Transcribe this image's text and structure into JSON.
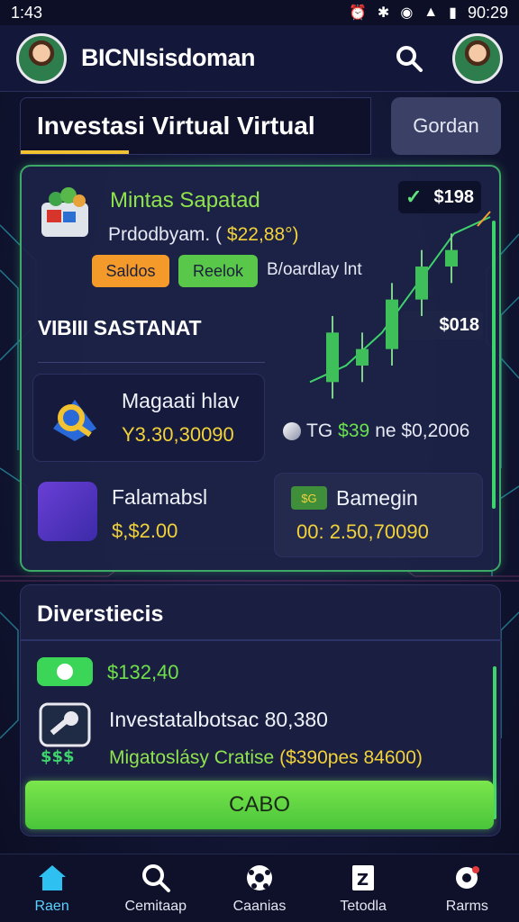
{
  "status_bar": {
    "time": "1:43",
    "clock": "90:29"
  },
  "header": {
    "title": "BICNIsisdoman"
  },
  "tabs": [
    {
      "label": "Investasi Virtual Virtual",
      "active": true
    },
    {
      "label": "Gordan",
      "active": false
    }
  ],
  "card": {
    "title": "Mintas Sapatad",
    "subtitle_prefix": "Prdodbyam. (",
    "subtitle_amount": "$22,88°)",
    "price_top": "$198",
    "badges": [
      "Saldos",
      "Reelok"
    ],
    "badge_side_text": "B/oardlay lnt",
    "section_label": "VIBIII SASTANAT",
    "price_mid": "$018",
    "sub_card_1": {
      "title": "Magaati hlav",
      "value": "Y3.30,30090"
    },
    "inline": {
      "prefix": "TG",
      "green": "$39",
      "suffix": "ne $0,2006"
    },
    "sub_card_2": {
      "title": "Falamabsl",
      "value": "$,$2.00"
    },
    "sub_card_3": {
      "icon_text": "$G",
      "title": "Bamegin",
      "value": "00: 2.50,70090"
    }
  },
  "panel2": {
    "title": "Diverstiecis",
    "cash_amount": "$132,40",
    "investment_title": "Investatalbotsac 80,380",
    "investment_sub_green": "Migatoslásy Cratise",
    "investment_sub_amount": "($390pes 84600)",
    "button_label": "CABO"
  },
  "bottom_nav": [
    {
      "label": "Raen",
      "icon": "home-icon",
      "active": true
    },
    {
      "label": "Cemitaap",
      "icon": "search-icon",
      "active": false
    },
    {
      "label": "Caanias",
      "icon": "soccer-ball-icon",
      "active": false
    },
    {
      "label": "Tetodla",
      "icon": "document-icon",
      "active": false
    },
    {
      "label": "Rarms",
      "icon": "gear-icon",
      "active": false
    }
  ],
  "colors": {
    "accent_green": "#58c74a",
    "accent_yellow": "#f2d23a",
    "accent_orange": "#f49a2a",
    "nav_active": "#5ad2ff"
  },
  "chart_data": {
    "type": "candlestick",
    "candles": [
      {
        "open": 2,
        "close": 5,
        "high": 6,
        "low": 1
      },
      {
        "open": 3,
        "close": 4,
        "high": 5,
        "low": 2
      },
      {
        "open": 4,
        "close": 7,
        "high": 8,
        "low": 3
      },
      {
        "open": 7,
        "close": 9,
        "high": 10,
        "low": 6
      },
      {
        "open": 9,
        "close": 10,
        "high": 11,
        "low": 8
      }
    ],
    "line": [
      2,
      3,
      5,
      8,
      11,
      12
    ]
  }
}
